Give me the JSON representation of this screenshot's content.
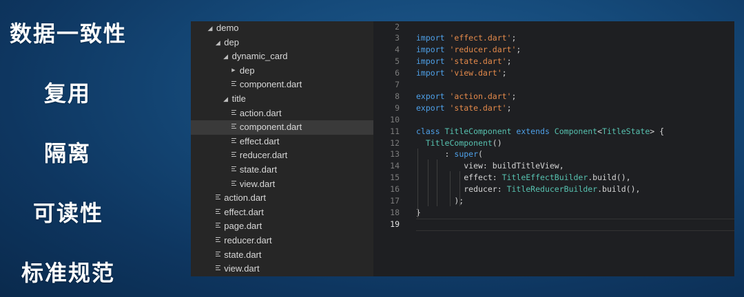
{
  "side_labels": [
    "数据一致性",
    "复用",
    "隔离",
    "可读性",
    "标准规范"
  ],
  "tree": [
    {
      "label": "demo",
      "kind": "folder",
      "open": true,
      "depth": 0
    },
    {
      "label": "dep",
      "kind": "folder",
      "open": true,
      "depth": 1
    },
    {
      "label": "dynamic_card",
      "kind": "folder",
      "open": true,
      "depth": 2
    },
    {
      "label": "dep",
      "kind": "folder",
      "open": false,
      "depth": 3
    },
    {
      "label": "component.dart",
      "kind": "file",
      "depth": 3
    },
    {
      "label": "title",
      "kind": "folder",
      "open": true,
      "depth": 2
    },
    {
      "label": "action.dart",
      "kind": "file",
      "depth": 3
    },
    {
      "label": "component.dart",
      "kind": "file",
      "depth": 3,
      "selected": true
    },
    {
      "label": "effect.dart",
      "kind": "file",
      "depth": 3
    },
    {
      "label": "reducer.dart",
      "kind": "file",
      "depth": 3
    },
    {
      "label": "state.dart",
      "kind": "file",
      "depth": 3
    },
    {
      "label": "view.dart",
      "kind": "file",
      "depth": 3
    },
    {
      "label": "action.dart",
      "kind": "file",
      "depth": 1
    },
    {
      "label": "effect.dart",
      "kind": "file",
      "depth": 1
    },
    {
      "label": "page.dart",
      "kind": "file",
      "depth": 1
    },
    {
      "label": "reducer.dart",
      "kind": "file",
      "depth": 1
    },
    {
      "label": "state.dart",
      "kind": "file",
      "depth": 1
    },
    {
      "label": "view.dart",
      "kind": "file",
      "depth": 1
    }
  ],
  "editor": {
    "current_line": "19",
    "lines": [
      {
        "n": "2",
        "tokens": []
      },
      {
        "n": "3",
        "tokens": [
          [
            "kw",
            "import "
          ],
          [
            "str",
            "'effect.dart'"
          ],
          [
            "fn",
            ";"
          ]
        ]
      },
      {
        "n": "4",
        "tokens": [
          [
            "kw",
            "import "
          ],
          [
            "str",
            "'reducer.dart'"
          ],
          [
            "fn",
            ";"
          ]
        ]
      },
      {
        "n": "5",
        "tokens": [
          [
            "kw",
            "import "
          ],
          [
            "str",
            "'state.dart'"
          ],
          [
            "fn",
            ";"
          ]
        ]
      },
      {
        "n": "6",
        "tokens": [
          [
            "kw",
            "import "
          ],
          [
            "str",
            "'view.dart'"
          ],
          [
            "fn",
            ";"
          ]
        ]
      },
      {
        "n": "7",
        "tokens": []
      },
      {
        "n": "8",
        "tokens": [
          [
            "kw",
            "export "
          ],
          [
            "str",
            "'action.dart'"
          ],
          [
            "fn",
            ";"
          ]
        ]
      },
      {
        "n": "9",
        "tokens": [
          [
            "kw",
            "export "
          ],
          [
            "str",
            "'state.dart'"
          ],
          [
            "fn",
            ";"
          ]
        ]
      },
      {
        "n": "10",
        "tokens": []
      },
      {
        "n": "11",
        "tokens": [
          [
            "kw",
            "class "
          ],
          [
            "cls",
            "TitleComponent"
          ],
          [
            "kw",
            " extends "
          ],
          [
            "cls",
            "Component"
          ],
          [
            "fn",
            "<"
          ],
          [
            "cls",
            "TitleState"
          ],
          [
            "fn",
            "> {"
          ]
        ]
      },
      {
        "n": "12",
        "tokens": [
          [
            "fn",
            "  "
          ],
          [
            "cls",
            "TitleComponent"
          ],
          [
            "fn",
            "()"
          ]
        ]
      },
      {
        "n": "13",
        "tokens": [
          [
            "fn",
            "      : "
          ],
          [
            "kw",
            "super"
          ],
          [
            "fn",
            "("
          ]
        ]
      },
      {
        "n": "14",
        "tokens": [
          [
            "fn",
            "          view: buildTitleView,"
          ]
        ]
      },
      {
        "n": "15",
        "tokens": [
          [
            "fn",
            "          effect: "
          ],
          [
            "cls",
            "TitleEffectBuilder"
          ],
          [
            "fn",
            ".build(),"
          ]
        ]
      },
      {
        "n": "16",
        "tokens": [
          [
            "fn",
            "          reducer: "
          ],
          [
            "cls",
            "TitleReducerBuilder"
          ],
          [
            "fn",
            ".build(),"
          ]
        ]
      },
      {
        "n": "17",
        "tokens": [
          [
            "fn",
            "        );"
          ]
        ]
      },
      {
        "n": "18",
        "tokens": [
          [
            "fn",
            "}"
          ]
        ]
      },
      {
        "n": "19",
        "tokens": []
      }
    ]
  }
}
